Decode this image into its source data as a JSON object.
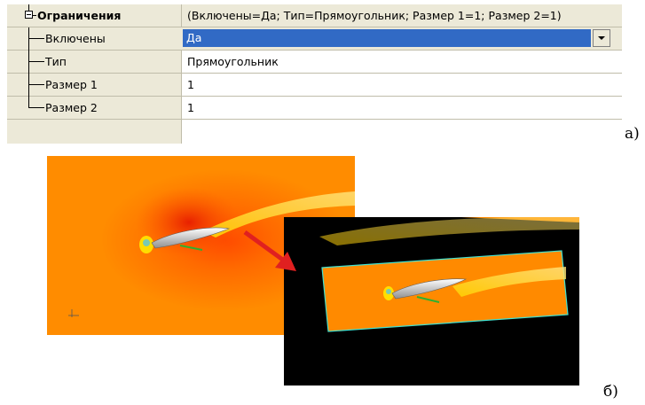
{
  "property_grid": {
    "header": {
      "name": "Ограничения",
      "value": "(Включены=Да; Тип=Прямоугольник; Размер 1=1; Размер 2=1)"
    },
    "rows": [
      {
        "name": "Включены",
        "value": "Да"
      },
      {
        "name": "Тип",
        "value": "Прямоугольник"
      },
      {
        "name": "Размер 1",
        "value": "1"
      },
      {
        "name": "Размер 2",
        "value": "1"
      }
    ]
  },
  "captions": {
    "a": "а)",
    "b": "б)"
  },
  "colors": {
    "selection": "#316ac5",
    "flow_field": "#ff8a00",
    "mask_edge": "#40e0d0"
  }
}
